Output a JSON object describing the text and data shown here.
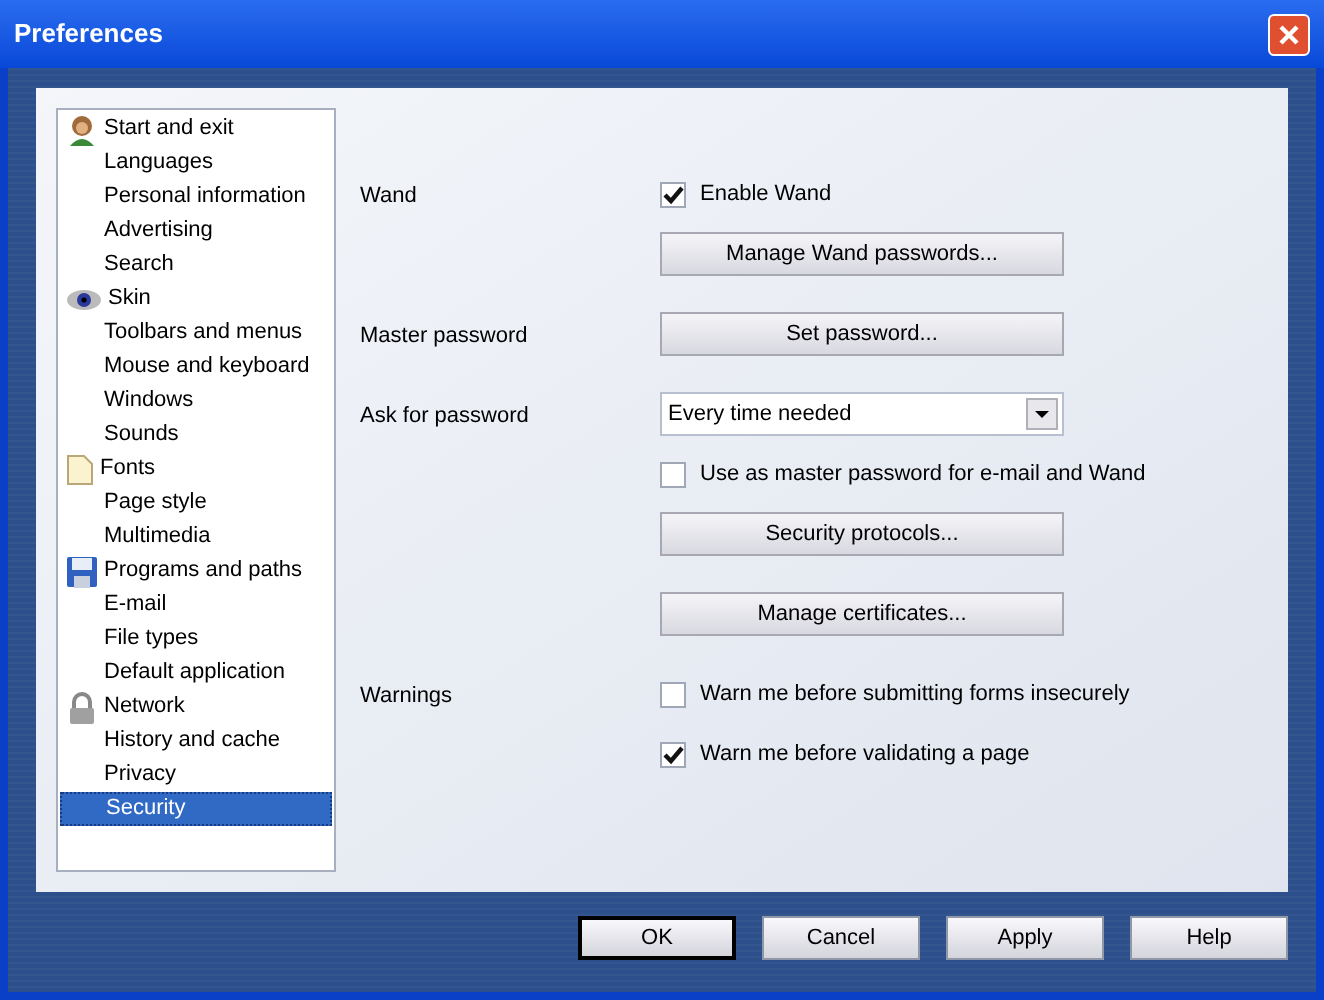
{
  "window": {
    "title": "Preferences"
  },
  "sidebar": {
    "items": [
      {
        "label": "Start and exit",
        "kind": "person",
        "selected": false
      },
      {
        "label": "Languages",
        "kind": "plain",
        "selected": false
      },
      {
        "label": "Personal information",
        "kind": "plain",
        "selected": false
      },
      {
        "label": "Advertising",
        "kind": "plain",
        "selected": false
      },
      {
        "label": "Search",
        "kind": "plain",
        "selected": false
      },
      {
        "label": "Skin",
        "kind": "eye",
        "selected": false
      },
      {
        "label": "Toolbars and menus",
        "kind": "plain",
        "selected": false
      },
      {
        "label": "Mouse and keyboard",
        "kind": "plain",
        "selected": false
      },
      {
        "label": "Windows",
        "kind": "plain",
        "selected": false
      },
      {
        "label": "Sounds",
        "kind": "plain",
        "selected": false
      },
      {
        "label": "Fonts",
        "kind": "document",
        "selected": false
      },
      {
        "label": "Page style",
        "kind": "plain",
        "selected": false
      },
      {
        "label": "Multimedia",
        "kind": "plain",
        "selected": false
      },
      {
        "label": "Programs and paths",
        "kind": "disk",
        "selected": false
      },
      {
        "label": "E-mail",
        "kind": "plain",
        "selected": false
      },
      {
        "label": "File types",
        "kind": "plain",
        "selected": false
      },
      {
        "label": "Default application",
        "kind": "plain",
        "selected": false
      },
      {
        "label": "Network",
        "kind": "lock",
        "selected": false
      },
      {
        "label": "History and cache",
        "kind": "plain",
        "selected": false
      },
      {
        "label": "Privacy",
        "kind": "plain",
        "selected": false
      },
      {
        "label": "Security",
        "kind": "plain",
        "selected": true
      }
    ]
  },
  "settings": [
    {
      "label": "Wand",
      "kind": "checkbox",
      "text": "Enable Wand",
      "checked": true
    },
    {
      "kind": "button",
      "text": "Manage Wand passwords..."
    },
    {
      "label": "Master password",
      "kind": "button",
      "text": "Set password..."
    },
    {
      "label": "Ask for password",
      "kind": "dropdown",
      "text": "Every time needed"
    },
    {
      "kind": "checkbox",
      "text": "Use as master password for e-mail and Wand",
      "checked": false
    },
    {
      "kind": "button",
      "text": "Security protocols..."
    },
    {
      "kind": "button",
      "text": "Manage certificates..."
    },
    {
      "label": "Warnings",
      "kind": "checkbox",
      "text": "Warn me before submitting forms insecurely",
      "checked": false
    },
    {
      "kind": "checkbox",
      "text": "Warn me before validating a page",
      "checked": true
    }
  ],
  "buttons": [
    {
      "label": "OK",
      "default": true
    },
    {
      "label": "Cancel",
      "default": false
    },
    {
      "label": "Apply",
      "default": false
    },
    {
      "label": "Help",
      "default": false
    }
  ]
}
